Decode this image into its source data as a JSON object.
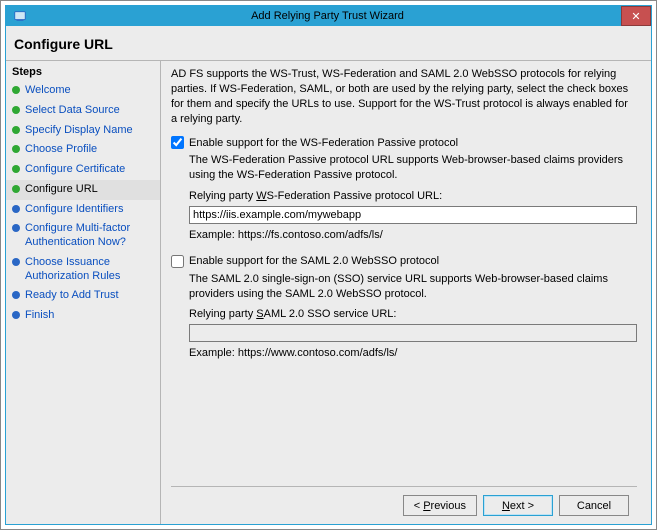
{
  "window": {
    "title": "Add Relying Party Trust Wizard",
    "close_glyph": "✕"
  },
  "header": "Configure URL",
  "steps_title": "Steps",
  "steps": [
    {
      "label": "Welcome",
      "bullet": "green"
    },
    {
      "label": "Select Data Source",
      "bullet": "green"
    },
    {
      "label": "Specify Display Name",
      "bullet": "green"
    },
    {
      "label": "Choose Profile",
      "bullet": "green"
    },
    {
      "label": "Configure Certificate",
      "bullet": "green"
    },
    {
      "label": "Configure URL",
      "bullet": "green",
      "current": true
    },
    {
      "label": "Configure Identifiers",
      "bullet": "blue"
    },
    {
      "label": "Configure Multi-factor Authentication Now?",
      "bullet": "blue"
    },
    {
      "label": "Choose Issuance Authorization Rules",
      "bullet": "blue"
    },
    {
      "label": "Ready to Add Trust",
      "bullet": "blue"
    },
    {
      "label": "Finish",
      "bullet": "blue"
    }
  ],
  "intro": "AD FS supports the WS-Trust, WS-Federation and SAML 2.0 WebSSO protocols for relying parties. If WS-Federation, SAML, or both are used by the relying party, select the check boxes for them and specify the URLs to use.  Support for the WS-Trust protocol is always enabled for a relying party.",
  "wsfed": {
    "checkbox_label": "Enable support for the WS-Federation Passive protocol",
    "checked": true,
    "desc": "The WS-Federation Passive protocol URL supports Web-browser-based claims providers using the WS-Federation Passive protocol.",
    "field_label_pre": "Relying party ",
    "field_label_u": "W",
    "field_label_post": "S-Federation Passive protocol URL:",
    "value": "https://iis.example.com/mywebapp",
    "example": "Example: https://fs.contoso.com/adfs/ls/"
  },
  "saml": {
    "checkbox_label": "Enable support for the SAML 2.0 WebSSO protocol",
    "checked": false,
    "desc": "The SAML 2.0 single-sign-on (SSO) service URL supports Web-browser-based claims providers using the SAML 2.0 WebSSO protocol.",
    "field_label_pre": "Relying party ",
    "field_label_u": "S",
    "field_label_post": "AML 2.0 SSO service URL:",
    "value": "",
    "example": "Example: https://www.contoso.com/adfs/ls/"
  },
  "buttons": {
    "previous_u": "P",
    "previous_rest": "revious",
    "next_u": "N",
    "next_rest": "ext >",
    "cancel": "Cancel"
  }
}
